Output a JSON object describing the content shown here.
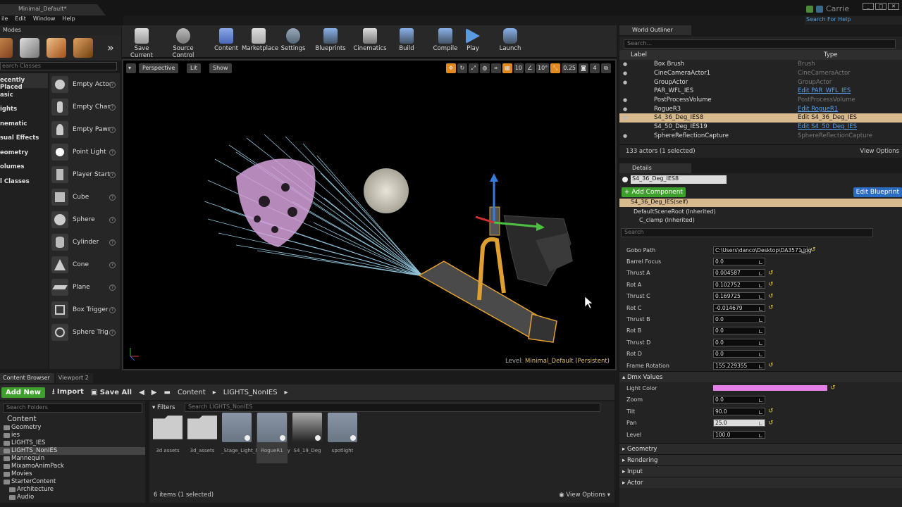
{
  "title": {
    "tab": "Minimal_Default*",
    "user": "Carrie",
    "help_placeholder": "Search For Help"
  },
  "menu": [
    "ile",
    "Edit",
    "Window",
    "Help"
  ],
  "modes": {
    "tab": "Modes",
    "search_placeholder": "earch Classes",
    "categories": [
      "ecently Placed",
      "asic",
      "ights",
      "nematic",
      "sual Effects",
      "eometry",
      "olumes",
      "l Classes"
    ],
    "items": [
      "Empty Actor",
      "Empty Char",
      "Empty Pawr",
      "Point Light",
      "Player Start",
      "Cube",
      "Sphere",
      "Cylinder",
      "Cone",
      "Plane",
      "Box Trigger",
      "Sphere Trig"
    ]
  },
  "toolbar": [
    "Save Current",
    "Source Control",
    "Content",
    "Marketplace",
    "Settings",
    "Blueprints",
    "Cinematics",
    "Build",
    "Compile",
    "Play",
    "Launch"
  ],
  "viewport": {
    "perspective": "Perspective",
    "lit": "Lit",
    "show": "Show",
    "grid_angle": "10°",
    "scale": "0.25",
    "cam_speed": "4",
    "level_prefix": "Level:",
    "level_name": "Minimal_Default (Persistent)"
  },
  "outliner": {
    "tab": "World Outliner",
    "search_placeholder": "Search...",
    "col_label": "Label",
    "col_type": "Type",
    "rows": [
      {
        "label": "Box Brush",
        "type": "Brush"
      },
      {
        "label": "CineCameraActor1",
        "type": "CineCameraActor"
      },
      {
        "label": "GroupActor",
        "type": "GroupActor"
      },
      {
        "label": "PAR_WFL_IES",
        "type": "Edit PAR_WFL_IES"
      },
      {
        "label": "PostProcessVolume",
        "type": "PostProcessVolume"
      },
      {
        "label": "RogueR3",
        "type": "Edit RogueR1"
      },
      {
        "label": "S4_36_Deg_IES8",
        "type": "Edit S4_36_Deg_IES"
      },
      {
        "label": "S4_50_Deg_IES19",
        "type": "Edit S4_50_Deg_IES"
      },
      {
        "label": "SphereReflectionCapture",
        "type": "SphereReflectionCapture"
      }
    ],
    "count": "133 actors (1 selected)",
    "view_options": "View Options"
  },
  "details": {
    "tab": "Details",
    "actor_name": "S4_36_Deg_IES8",
    "add_component": "+ Add Component",
    "edit_blueprint": "Edit Blueprint",
    "self_row": "S4_36_Deg_IES(self)",
    "tree": [
      "DefaultSceneRoot (Inherited)",
      "C_clamp (Inherited)"
    ],
    "search_placeholder": "Search",
    "props": [
      {
        "label": "Gobo Path",
        "value": "C:\\Users\\danco\\Desktop\\DA3571.jpg"
      },
      {
        "label": "Barrel Focus",
        "value": "0.0"
      },
      {
        "label": "Thrust A",
        "value": "0.004587"
      },
      {
        "label": "Rot A",
        "value": "0.102752"
      },
      {
        "label": "Thrust C",
        "value": "0.169725"
      },
      {
        "label": "Rot C",
        "value": "-0.014679"
      },
      {
        "label": "Thrust B",
        "value": "0.0"
      },
      {
        "label": "Rot B",
        "value": "0.0"
      },
      {
        "label": "Thrust D",
        "value": "0.0"
      },
      {
        "label": "Rot D",
        "value": "0.0"
      },
      {
        "label": "Frame Rotation",
        "value": "155.229355"
      }
    ],
    "dmx_section": "Dmx Values",
    "dmx": [
      {
        "label": "Light Color",
        "value": ""
      },
      {
        "label": "Zoom",
        "value": "0.0"
      },
      {
        "label": "Tilt",
        "value": "90.0"
      },
      {
        "label": "Pan",
        "value": "25.0"
      },
      {
        "label": "Level",
        "value": "100.0"
      }
    ],
    "light_color": "#e37fe6",
    "sections": [
      "Geometry",
      "Rendering",
      "Input",
      "Actor"
    ]
  },
  "content_browser": {
    "tabs": [
      "Content Browser",
      "Viewport 2"
    ],
    "add_new": "Add New",
    "import": "Import",
    "save_all": "Save All",
    "crumbs": [
      "Content",
      "LIGHTS_NonIES"
    ],
    "folder_search": "Search Folders",
    "filters": "Filters",
    "asset_search": "Search LIGHTS_NonIES",
    "tree": [
      "Content",
      "Geometry",
      "ies",
      "LIGHTS_IES",
      "LIGHTS_NonIES",
      "Mannequin",
      "MixamoAnimPack",
      "Movies",
      "StarterContent",
      "Architecture",
      "Audio"
    ],
    "assets": [
      "3d assets",
      "3d_assets",
      "_Stage_Light_NonIESLegacy",
      "RogueR1",
      "S4_19_Deg",
      "spotlight"
    ],
    "status": "6 items (1 selected)",
    "view_options": "View Options"
  }
}
